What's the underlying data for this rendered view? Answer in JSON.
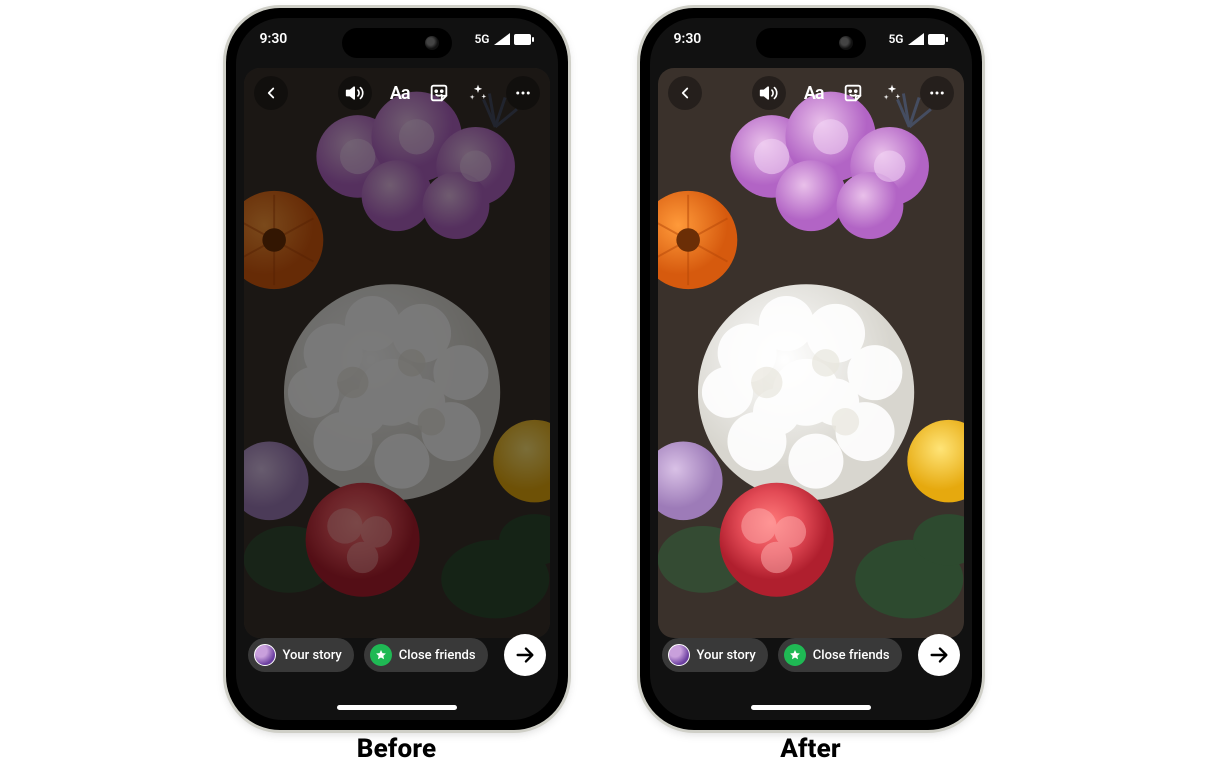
{
  "status": {
    "time": "9:30",
    "network": "5G"
  },
  "bottom": {
    "your_story": "Your story",
    "close_friends": "Close friends"
  },
  "captions": {
    "before": "Before",
    "after": "After"
  },
  "toolbar": {
    "text_label": "Aa"
  }
}
